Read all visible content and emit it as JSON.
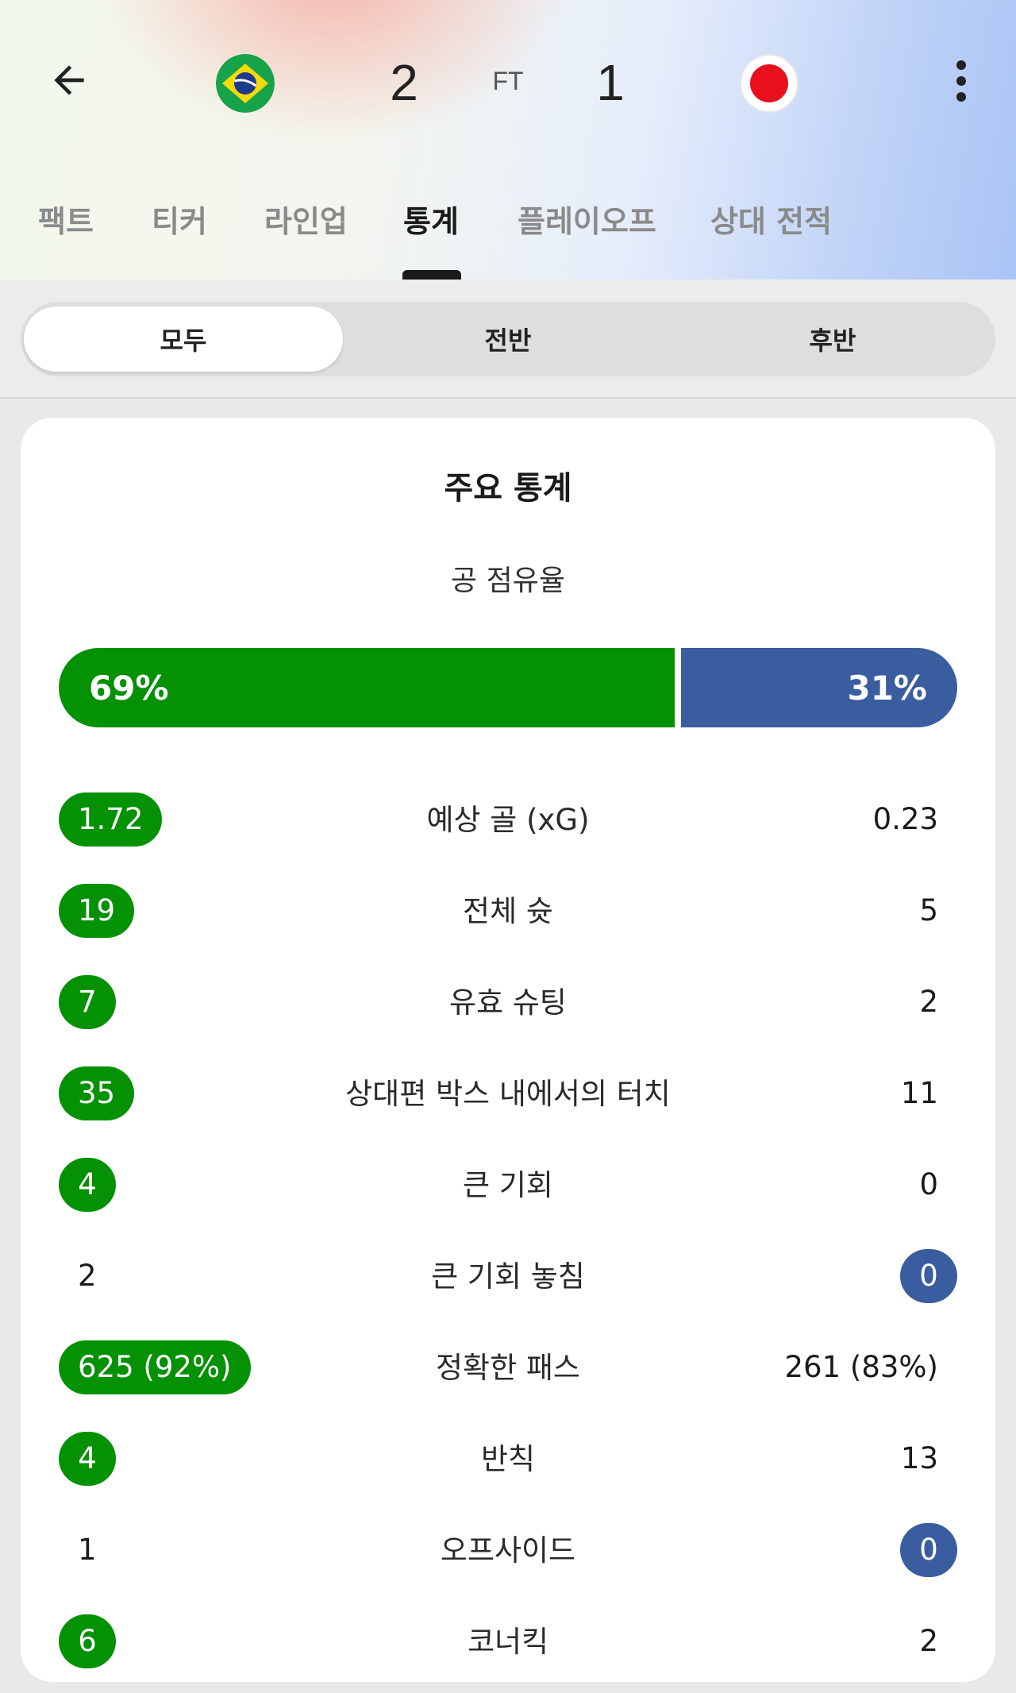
{
  "colors": {
    "home_team": "#049104",
    "away_team": "#3a5da0"
  },
  "header": {
    "back_icon": "arrow-left-icon",
    "home_flag": "brazil-flag-icon",
    "away_flag": "japan-flag-icon",
    "home_score": "2",
    "away_score": "1",
    "status": "FT",
    "more_icon": "more-vertical-icon"
  },
  "tabs": [
    {
      "label": "팩트",
      "active": false
    },
    {
      "label": "티커",
      "active": false
    },
    {
      "label": "라인업",
      "active": false
    },
    {
      "label": "통계",
      "active": true
    },
    {
      "label": "플레이오프",
      "active": false
    },
    {
      "label": "상대 전적",
      "active": false
    }
  ],
  "segments": [
    {
      "label": "모두",
      "active": true
    },
    {
      "label": "전반",
      "active": false
    },
    {
      "label": "후반",
      "active": false
    }
  ],
  "card": {
    "title": "주요 통계",
    "possession": {
      "label": "공 점유율",
      "home": "69%",
      "away": "31%",
      "home_fraction": 0.69,
      "away_fraction": 0.31
    },
    "stats": [
      {
        "name": "예상 골 (xG)",
        "home": "1.72",
        "away": "0.23",
        "leader": "home"
      },
      {
        "name": "전체 슛",
        "home": "19",
        "away": "5",
        "leader": "home"
      },
      {
        "name": "유효 슈팅",
        "home": "7",
        "away": "2",
        "leader": "home"
      },
      {
        "name": "상대편 박스 내에서의 터치",
        "home": "35",
        "away": "11",
        "leader": "home"
      },
      {
        "name": "큰 기회",
        "home": "4",
        "away": "0",
        "leader": "home"
      },
      {
        "name": "큰 기회 놓침",
        "home": "2",
        "away": "0",
        "leader": "away"
      },
      {
        "name": "정확한 패스",
        "home": "625 (92%)",
        "away": "261 (83%)",
        "leader": "home"
      },
      {
        "name": "반칙",
        "home": "4",
        "away": "13",
        "leader": "home"
      },
      {
        "name": "오프사이드",
        "home": "1",
        "away": "0",
        "leader": "away"
      },
      {
        "name": "코너킥",
        "home": "6",
        "away": "2",
        "leader": "home"
      }
    ]
  }
}
